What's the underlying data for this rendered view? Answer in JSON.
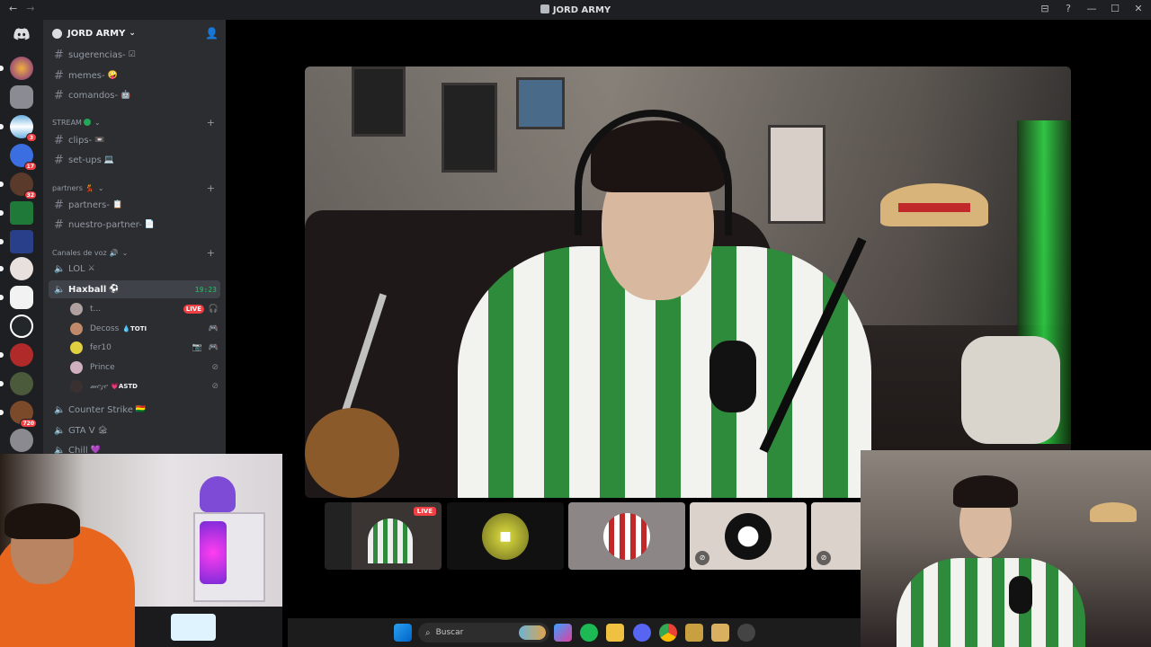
{
  "window": {
    "title": "JORD ARMY",
    "controls": [
      "⊟",
      "?",
      "—",
      "☐",
      "✕"
    ]
  },
  "server": {
    "name": "JORD ARMY",
    "caret": "⌄"
  },
  "channels": [
    {
      "name": "sugerencias-",
      "emoji": "☑"
    },
    {
      "name": "memes-",
      "emoji": "🤪"
    },
    {
      "name": "comandos-",
      "emoji": "🤖"
    }
  ],
  "categories": {
    "stream": {
      "name": "STREAM",
      "channels": [
        {
          "name": "clips-",
          "emoji": "📼"
        },
        {
          "name": "set-ups",
          "emoji": "💻"
        }
      ]
    },
    "partners": {
      "name": "partners",
      "emoji": "💃",
      "channels": [
        {
          "name": "partners-",
          "emoji": "📋"
        },
        {
          "name": "nuestro-partner-",
          "emoji": "📄"
        }
      ]
    },
    "voice": {
      "name": "Canales de voz",
      "emoji": "🔊"
    }
  },
  "voice_channels": {
    "lol": {
      "name": "LOL",
      "emoji": "⚔"
    },
    "haxball": {
      "name": "Haxball",
      "emoji": "⚽",
      "timer": "19:23"
    },
    "counter_strike": {
      "name": "Counter Strike",
      "emoji": "🇧🇴"
    },
    "gta": {
      "name": "GTA V",
      "emoji": "🏚"
    },
    "chill": {
      "name": "Chill",
      "emoji": "💜"
    }
  },
  "voice_users": [
    {
      "name": "t...",
      "live": "LIVE"
    },
    {
      "name": "Decoss",
      "tag": "TOTI"
    },
    {
      "name": "fer10"
    },
    {
      "name": "Prince"
    },
    {
      "name": "𝓂𝑒𝓏𝑒",
      "tag": "ASTD"
    }
  ],
  "guild_badges": [
    "3",
    "17",
    "32",
    "720"
  ],
  "stream": {
    "live_label": "LIVE"
  },
  "taskbar": {
    "search_placeholder": "Buscar"
  },
  "colors": {
    "accent_green": "#23a55a",
    "live_red": "#f23f43",
    "sidebar": "#2b2d31",
    "guildbar": "#1e1f22"
  }
}
